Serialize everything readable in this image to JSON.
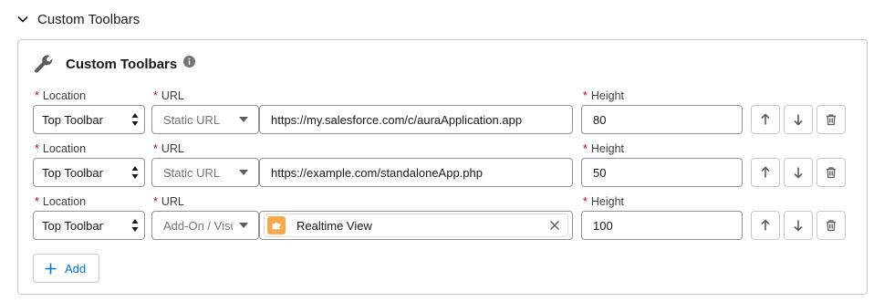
{
  "section": {
    "title": "Custom Toolbars"
  },
  "card": {
    "title": "Custom Toolbars"
  },
  "labels": {
    "required": "*",
    "location": "Location",
    "url": "URL",
    "height": "Height"
  },
  "rows": [
    {
      "location": "Top Toolbar",
      "url_type": "Static URL",
      "url_value": "https://my.salesforce.com/c/auraApplication.app",
      "height": "80"
    },
    {
      "location": "Top Toolbar",
      "url_type": "Static URL",
      "url_value": "https://example.com/standaloneApp.php",
      "height": "50"
    },
    {
      "location": "Top Toolbar",
      "url_type": "Add-On / Visualforce",
      "url_value": "Realtime View",
      "height": "100"
    }
  ],
  "buttons": {
    "add": "Add"
  },
  "icons": {
    "section_toggle": "chevron-down-icon",
    "card": "wrench-icon",
    "info": "info-icon",
    "move_up": "arrow-up-icon",
    "move_down": "arrow-down-icon",
    "delete": "trash-icon",
    "add": "plus-icon",
    "clear": "close-icon",
    "addon": "puzzle-icon"
  },
  "colors": {
    "brand": "#0176d3",
    "required": "#ba0517",
    "addon_icon_bg": "#f9a84a"
  }
}
